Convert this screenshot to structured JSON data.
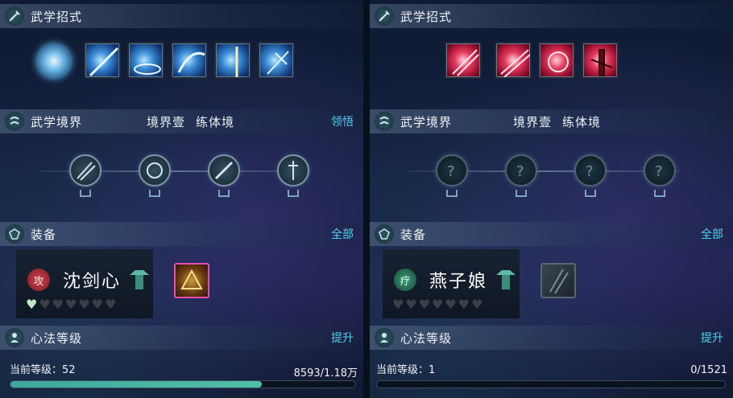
{
  "panels": [
    {
      "skills_header": {
        "title": "武学招式"
      },
      "realm_header": {
        "title": "武学境界",
        "realm": "境界壹",
        "stage": "练体境",
        "action": "领悟"
      },
      "equip_header": {
        "title": "装备",
        "action": "全部"
      },
      "character": {
        "badge": "攻",
        "name": "沈剑心",
        "hearts_total": 7,
        "hearts_filled": 1
      },
      "level_header": {
        "title": "心法等级",
        "action": "提升"
      },
      "level": {
        "label": "当前等级：52",
        "progress_text": "8593/1.18万",
        "fill_fraction": 0.73
      },
      "skill_color": "blue",
      "realm_nodes_unlocked": true
    },
    {
      "skills_header": {
        "title": "武学招式"
      },
      "realm_header": {
        "title": "武学境界",
        "realm": "境界壹",
        "stage": "练体境"
      },
      "equip_header": {
        "title": "装备",
        "action": "全部"
      },
      "character": {
        "badge": "疗",
        "name": "燕子娘",
        "hearts_total": 7,
        "hearts_filled": 0
      },
      "level_header": {
        "title": "心法等级",
        "action": "提升"
      },
      "level": {
        "label": "当前等级：1",
        "progress_text": "0/1521",
        "fill_fraction": 0
      },
      "skill_color": "red",
      "realm_nodes_unlocked": false
    }
  ],
  "colors": {
    "accent_link": "#4fd1ef",
    "level_bar": "#4fc0a8",
    "attack_badge": "#b0313a",
    "heal_badge": "#2f7e62"
  }
}
